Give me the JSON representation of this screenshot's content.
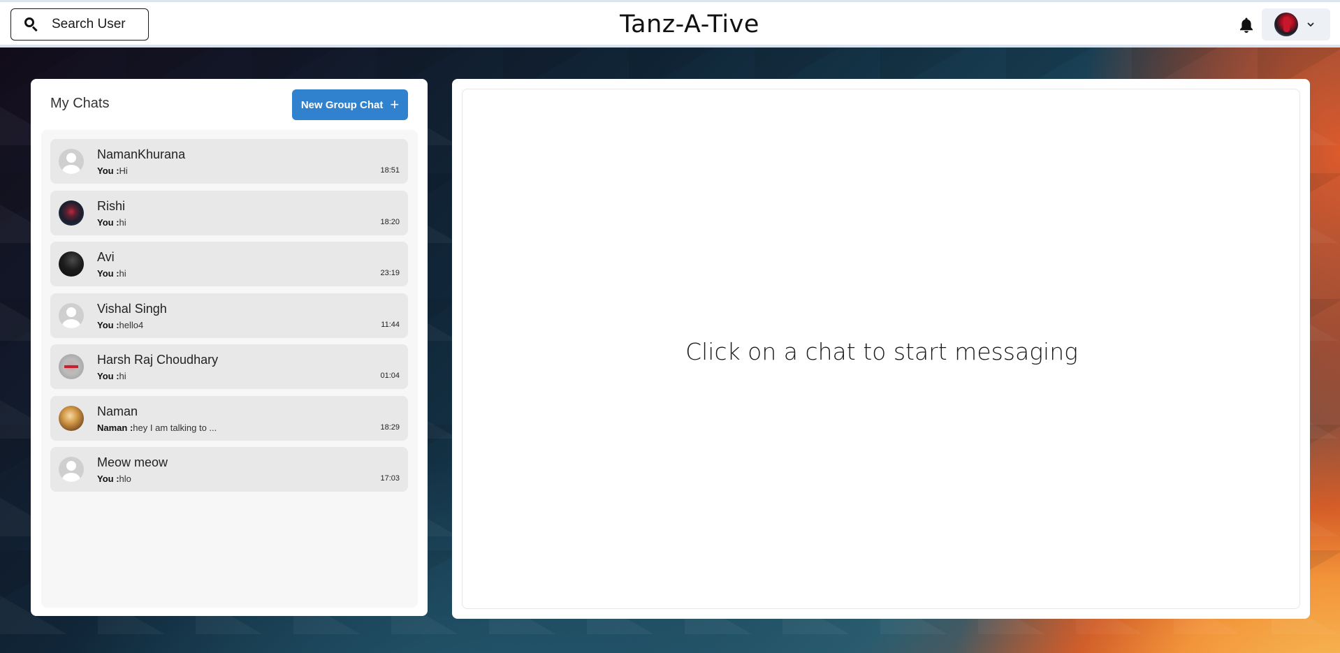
{
  "header": {
    "search_label": "Search User",
    "app_title": "Tanz-A-Tive",
    "icons": [
      "search-icon",
      "bell-icon",
      "chevron-down-icon"
    ]
  },
  "sidebar": {
    "title": "My Chats",
    "new_group_label": "New Group Chat",
    "new_group_icon": "+",
    "chats": [
      {
        "name": "NamanKhurana",
        "sender": "You :",
        "message": "Hi",
        "time": "18:51"
      },
      {
        "name": "Rishi",
        "sender": "You :",
        "message": "hi",
        "time": "18:20"
      },
      {
        "name": "Avi",
        "sender": "You :",
        "message": "hi",
        "time": "23:19"
      },
      {
        "name": "Vishal Singh",
        "sender": "You :",
        "message": "hello4",
        "time": "11:44"
      },
      {
        "name": "Harsh Raj Choudhary",
        "sender": "You :",
        "message": "hi",
        "time": "01:04"
      },
      {
        "name": "Naman",
        "sender": "Naman :",
        "message": "hey I am talking to ...",
        "time": "18:29"
      },
      {
        "name": "Meow meow",
        "sender": "You :",
        "message": "hlo",
        "time": "17:03"
      }
    ]
  },
  "main": {
    "placeholder": "Click on a chat to start messaging"
  },
  "colors": {
    "accent": "#3182ce",
    "chat_item_bg": "#e8e8e8",
    "list_bg": "#f7f7f7"
  }
}
